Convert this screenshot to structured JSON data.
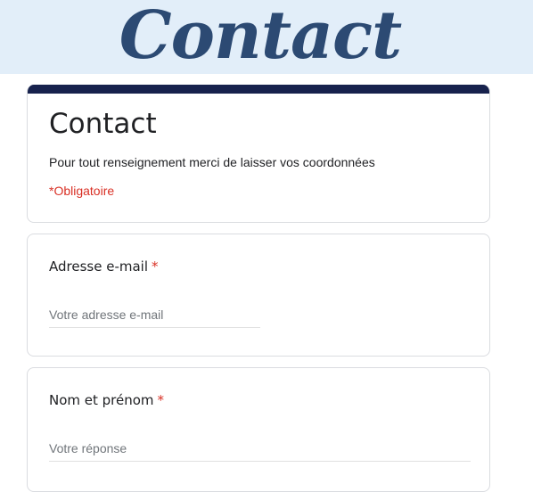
{
  "banner": {
    "title": "Contact"
  },
  "form": {
    "title": "Contact",
    "description": "Pour tout renseignement merci de laisser vos coordonnées",
    "required_note": "*Obligatoire",
    "header_color": "#17224d"
  },
  "questions": [
    {
      "label": "Adresse e-mail",
      "required_mark": "*",
      "placeholder": "Votre adresse e-mail"
    },
    {
      "label": "Nom et prénom",
      "required_mark": "*",
      "placeholder": "Votre réponse"
    }
  ]
}
